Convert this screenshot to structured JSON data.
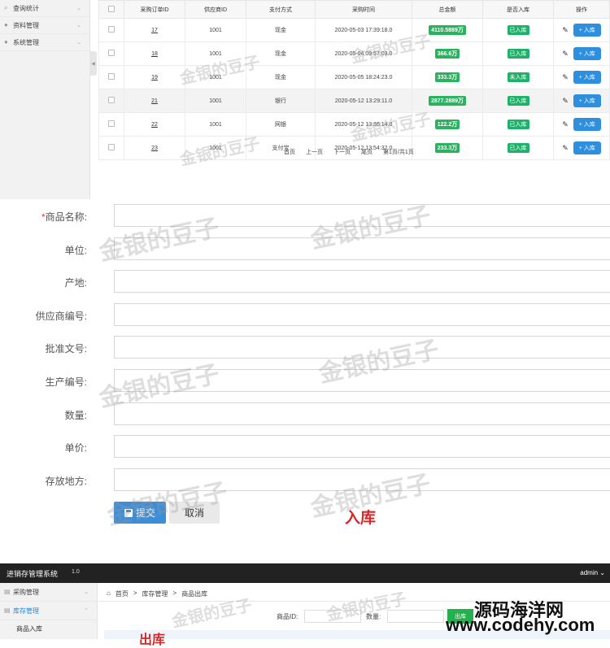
{
  "top_panel": {
    "sidebar": [
      {
        "label": "查询统计",
        "icon": "search-icon"
      },
      {
        "label": "资料管理",
        "icon": "user-icon"
      },
      {
        "label": "系统管理",
        "icon": "user-icon"
      }
    ],
    "table": {
      "headers": [
        "",
        "采购订单ID",
        "供应商ID",
        "支付方式",
        "采购时间",
        "总金额",
        "是否入库",
        "操作"
      ],
      "rows": [
        {
          "id": "17",
          "supplier": "1001",
          "pay": "现金",
          "time": "2020-05-03 17:39:18.0",
          "amount": "4110.5889万",
          "status": "已入库"
        },
        {
          "id": "18",
          "supplier": "1001",
          "pay": "现金",
          "time": "2020-05-04 09:57:03.0",
          "amount": "366.6万",
          "status": "已入库"
        },
        {
          "id": "19",
          "supplier": "1001",
          "pay": "现金",
          "time": "2020-05-05 18:24:23.0",
          "amount": "333.3万",
          "status": "未入库"
        },
        {
          "id": "21",
          "supplier": "1001",
          "pay": "银行",
          "time": "2020-05-12 13:29:11.0",
          "amount": "2877.2889万",
          "status": "已入库"
        },
        {
          "id": "22",
          "supplier": "1001",
          "pay": "网银",
          "time": "2020-05-12 13:36:14.0",
          "amount": "122.2万",
          "status": "已入库"
        },
        {
          "id": "23",
          "supplier": "1001",
          "pay": "支付宝",
          "time": "2020-05-12 13:54:32.0",
          "amount": "233.3万",
          "status": "已入库"
        }
      ],
      "action_label": "+ 入库"
    },
    "pager": {
      "first": "首页",
      "prev": "上一页",
      "next": "下一页",
      "last": "尾页",
      "info": "第1页/共1页"
    }
  },
  "form": {
    "fields": [
      {
        "label": "商品名称:",
        "required": true
      },
      {
        "label": "单位:",
        "required": false
      },
      {
        "label": "产地:",
        "required": false
      },
      {
        "label": "供应商编号:",
        "required": false
      },
      {
        "label": "批准文号:",
        "required": false
      },
      {
        "label": "生产编号:",
        "required": false
      },
      {
        "label": "数量:",
        "required": false
      },
      {
        "label": "单价:",
        "required": false
      },
      {
        "label": "存放地方:",
        "required": false
      }
    ],
    "required_mark": "*",
    "submit_label": "提交",
    "cancel_label": "取消",
    "caption": "入库"
  },
  "bottom_panel": {
    "brand": "进销存管理系统",
    "version": "1.0",
    "user": "admin",
    "sidebar": [
      {
        "label": "采购管理"
      },
      {
        "label": "库存管理",
        "active": true
      }
    ],
    "sub_item": "商品入库",
    "breadcrumb": [
      "首页",
      ">",
      "库存管理",
      ">",
      "商品出库"
    ],
    "query": {
      "id_label": "商品ID:",
      "qty_label": "数量:",
      "button": "出库"
    },
    "caption": "出库"
  },
  "watermark": "金银的豆子",
  "site_badge": {
    "name": "源码海洋网",
    "url": "www.codehy.com"
  },
  "colors": {
    "primary": "#3d8ed8",
    "success": "#1fb16a",
    "danger": "#d62828",
    "nav": "#222222"
  }
}
